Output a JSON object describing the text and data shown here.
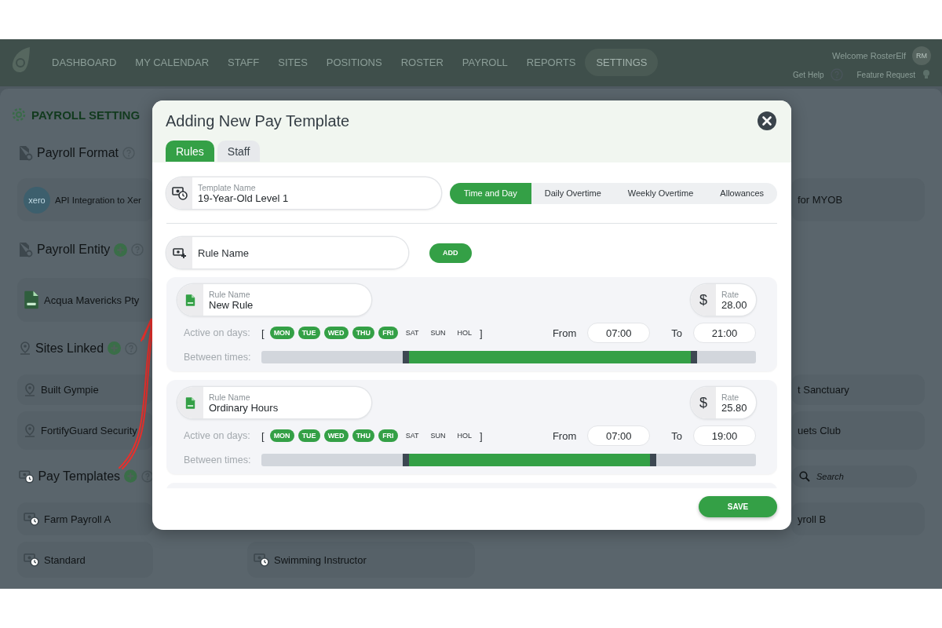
{
  "nav": {
    "items": [
      {
        "label": "DASHBOARD",
        "selected": false
      },
      {
        "label": "MY CALENDAR",
        "selected": false
      },
      {
        "label": "STAFF",
        "selected": false
      },
      {
        "label": "SITES",
        "selected": false
      },
      {
        "label": "POSITIONS",
        "selected": false
      },
      {
        "label": "ROSTER",
        "selected": false
      },
      {
        "label": "PAYROLL",
        "selected": false
      },
      {
        "label": "REPORTS",
        "selected": false
      },
      {
        "label": "SETTINGS",
        "selected": true
      }
    ],
    "welcome": "Welcome RosterElf",
    "avatar": "RM",
    "help": "Get Help",
    "feature": "Feature Request"
  },
  "settings_page": {
    "title": "PAYROLL SETTING",
    "payroll_format": {
      "title": "Payroll Format",
      "logo": "xero",
      "options": [
        "API Integration to Xer",
        "for MYOB"
      ]
    },
    "payroll_entity": {
      "title": "Payroll Entity",
      "entities": [
        "Acqua Mavericks Pty"
      ]
    },
    "sites_linked": {
      "title": "Sites Linked",
      "sites": [
        "Built Gympie",
        "t Sanctuary",
        "FortifyGuard Security",
        "uets Club"
      ]
    },
    "pay_templates": {
      "title": "Pay Templates",
      "search_placeholder": "Search",
      "templates": [
        "Farm Payroll A",
        "yroll B",
        "Standard",
        "Swimming Instructor"
      ]
    }
  },
  "modal": {
    "title": "Adding New Pay Template",
    "tabs": [
      {
        "label": "Rules",
        "selected": true
      },
      {
        "label": "Staff",
        "selected": false
      }
    ],
    "template_name": {
      "label": "Template Name",
      "value": "19-Year-Old Level 1"
    },
    "rule_types": [
      {
        "label": "Time and Day",
        "selected": true
      },
      {
        "label": "Daily Overtime",
        "selected": false
      },
      {
        "label": "Weekly Overtime",
        "selected": false
      },
      {
        "label": "Allowances",
        "selected": false
      }
    ],
    "new_rule": {
      "placeholder": "Rule Name",
      "button": "ADD"
    },
    "rules": [
      {
        "name_label": "Rule Name",
        "name": "New Rule",
        "rate_label": "Rate",
        "currency": "$",
        "rate": "28.00",
        "days_label": "Active on days:",
        "bracket_open": "[",
        "days": [
          {
            "label": "MON",
            "selected": true
          },
          {
            "label": "TUE",
            "selected": true
          },
          {
            "label": "WED",
            "selected": true
          },
          {
            "label": "THU",
            "selected": true
          },
          {
            "label": "FRI",
            "selected": true
          },
          {
            "label": "SAT",
            "selected": false
          },
          {
            "label": "SUN",
            "selected": false
          },
          {
            "label": "HOL",
            "selected": false
          }
        ],
        "bracket_close": "]",
        "from_label": "From",
        "from": "07:00",
        "to_label": "To",
        "to": "21:00",
        "times_label": "Between times:",
        "start_handle": {
          "level": 0.2917
        },
        "end_handle": {
          "level": 0.875
        }
      },
      {
        "name_label": "Rule Name",
        "name": "Ordinary Hours",
        "rate_label": "Rate",
        "currency": "$",
        "rate": "25.80",
        "days_label": "Active on days:",
        "bracket_open": "[",
        "days": [
          {
            "label": "MON",
            "selected": true
          },
          {
            "label": "TUE",
            "selected": true
          },
          {
            "label": "WED",
            "selected": true
          },
          {
            "label": "THU",
            "selected": true
          },
          {
            "label": "FRI",
            "selected": true
          },
          {
            "label": "SAT",
            "selected": false
          },
          {
            "label": "SUN",
            "selected": false
          },
          {
            "label": "HOL",
            "selected": false
          }
        ],
        "bracket_close": "]",
        "from_label": "From",
        "from": "07:00",
        "to_label": "To",
        "to": "19:00",
        "times_label": "Between times:",
        "start_handle": {
          "level": 0.2917
        },
        "end_handle": {
          "level": 0.7917
        }
      }
    ],
    "save": "SAVE"
  }
}
